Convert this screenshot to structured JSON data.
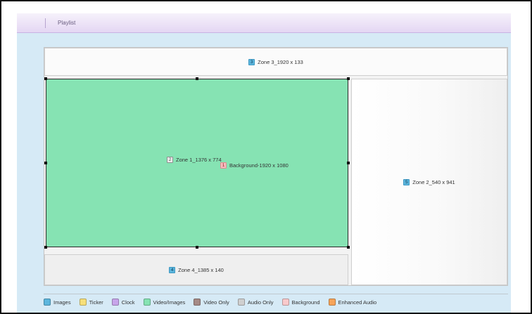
{
  "tabbar": {
    "label": "Playlist"
  },
  "zones": {
    "zone3": {
      "number": "3",
      "label": "Zone 3_1920 x 133",
      "color": "#ffffff"
    },
    "zone1": {
      "number": "2",
      "label": "Zone 1_1376 x 774",
      "color": "#86e3b3"
    },
    "background": {
      "number": "1",
      "label": "Background-1920 x 1080"
    },
    "zone2": {
      "number": "5",
      "label": "Zone 2_540 x 941"
    },
    "zone4": {
      "number": "4",
      "label": "Zone 4_1385 x 140"
    }
  },
  "legend": [
    {
      "label": "Images",
      "color": "#5cb6dd"
    },
    {
      "label": "Ticker",
      "color": "#f6df7a"
    },
    {
      "label": "Clock",
      "color": "#c7a5ea"
    },
    {
      "label": "Video/Images",
      "color": "#86e3b3"
    },
    {
      "label": "Video Only",
      "color": "#a58a86"
    },
    {
      "label": "Audio Only",
      "color": "#cfcfcf"
    },
    {
      "label": "Background",
      "color": "#f8c9cb"
    },
    {
      "label": "Enhanced Audio",
      "color": "#f6a45a"
    }
  ]
}
